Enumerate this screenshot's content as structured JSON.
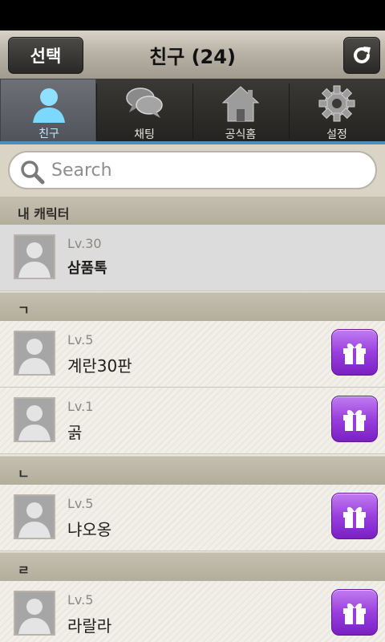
{
  "header": {
    "select_label": "선택",
    "title": "친구 (24)"
  },
  "tabs": [
    {
      "label": "친구",
      "icon": "person-icon",
      "active": true
    },
    {
      "label": "채팅",
      "icon": "chat-bubbles-icon",
      "active": false
    },
    {
      "label": "공식홈",
      "icon": "home-icon",
      "active": false
    },
    {
      "label": "설정",
      "icon": "gear-icon",
      "active": false
    }
  ],
  "search": {
    "placeholder": "Search"
  },
  "sections": {
    "my_character": "내 캐릭터",
    "g": "ㄱ",
    "n": "ㄴ",
    "r": "ㄹ"
  },
  "my_character": {
    "level": "Lv.30",
    "name": "삼품톡"
  },
  "friends": [
    {
      "level": "Lv.5",
      "name": "계란30판"
    },
    {
      "level": "Lv.1",
      "name": "곩"
    },
    {
      "level": "Lv.5",
      "name": "냐오옹"
    },
    {
      "level": "Lv.5",
      "name": "라랄라"
    }
  ],
  "colors": {
    "active_tab_text": "#bfe8ff",
    "gift_button": "#9a3fdd",
    "tab_underline": "#4b8fbf"
  }
}
